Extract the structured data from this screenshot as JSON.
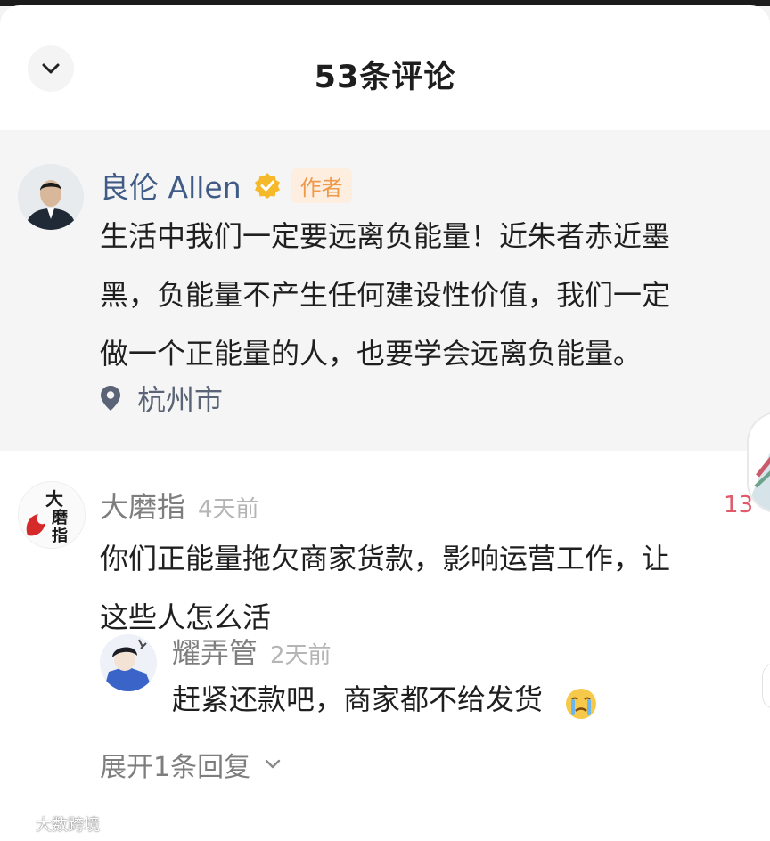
{
  "header": {
    "title": "53条评论",
    "collapse_icon": "chevron-down-icon"
  },
  "author_comment": {
    "name": "良伦 Allen",
    "badge": "作者",
    "verified_icon": "verified-badge-icon",
    "lines": [
      "生活中我们一定要远离负能量！近朱者赤近墨",
      "黑，负能量不产生任何建设性价值，我们一定",
      "做一个正能量的人，也要学会远离负能量。"
    ],
    "location_icon": "location-pin-icon",
    "location": "杭州市"
  },
  "comment": {
    "user": "大磨指",
    "time": "4天前",
    "likes": "13",
    "lines": [
      "你们正能量拖欠商家货款，影响运营工作，让",
      "这些人怎么活"
    ]
  },
  "reply": {
    "user": "耀弄管",
    "time": "2天前",
    "text": "赶紧还款吧，商家都不给发货",
    "emoji_icon": "crying-face-icon"
  },
  "expand": {
    "label": "展开1条回复"
  },
  "watermark": {
    "text": "大数跨境"
  },
  "colors": {
    "author_name": "#3f5b86",
    "badge_text": "#ef9a4a",
    "likes": "#e05a6a",
    "muted": "#7e7e7e"
  }
}
